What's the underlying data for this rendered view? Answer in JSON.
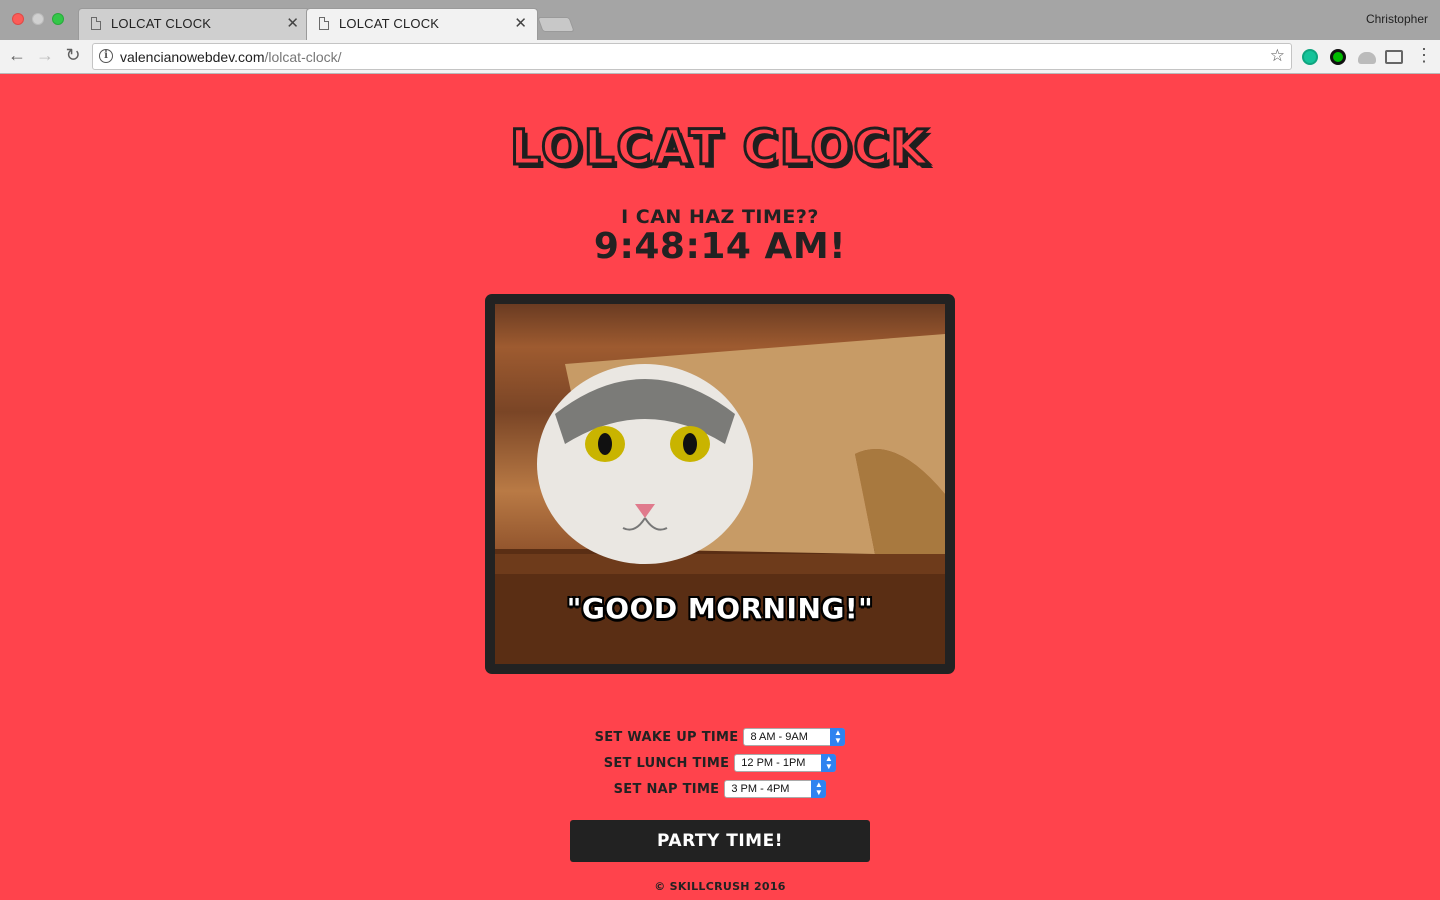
{
  "browser": {
    "tabs": [
      {
        "title": "LOLCAT CLOCK",
        "active": false
      },
      {
        "title": "LOLCAT CLOCK",
        "active": true
      }
    ],
    "profile_name": "Christopher",
    "url_host": "valencianowebdev.com",
    "url_path": "/lolcat-clock/"
  },
  "page": {
    "title": "LOLCAT CLOCK",
    "tagline": "I CAN HAZ TIME??",
    "clock": "9:48:14 AM!",
    "image_caption": "\"GOOD MORNING!\"",
    "controls": [
      {
        "label": "SET WAKE UP TIME",
        "selected": "8 AM - 9AM"
      },
      {
        "label": "SET LUNCH TIME",
        "selected": "12 PM - 1PM"
      },
      {
        "label": "SET NAP TIME",
        "selected": "3 PM - 4PM"
      }
    ],
    "button_label": "PARTY TIME!",
    "footer": "© SKILLCRUSH 2016"
  },
  "colors": {
    "background": "#ff434c",
    "dark": "#222222",
    "select_accent": "#2f83f0"
  }
}
